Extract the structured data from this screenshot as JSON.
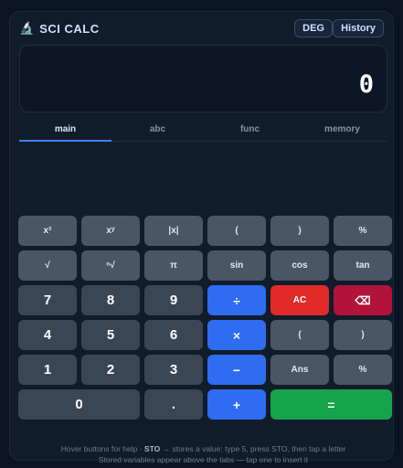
{
  "app": {
    "title": "SCI CALC",
    "icon": "microscope-icon",
    "deg_label": "DEG",
    "history_label": "History"
  },
  "display": {
    "value": "0"
  },
  "tabs": [
    {
      "label": "main",
      "active": true
    },
    {
      "label": "abc",
      "active": false
    },
    {
      "label": "func",
      "active": false
    },
    {
      "label": "memory",
      "active": false
    }
  ],
  "keys": {
    "r1": [
      "x²",
      "xʸ",
      "|x|",
      "(",
      ")",
      "%"
    ],
    "r2": [
      "√",
      "ⁿ√",
      "π",
      "sin",
      "cos",
      "tan"
    ],
    "r3": [
      "7",
      "8",
      "9",
      "÷",
      "AC",
      "⌫"
    ],
    "r4": [
      "4",
      "5",
      "6",
      "×",
      "(",
      ")"
    ],
    "r5": [
      "1",
      "2",
      "3",
      "−",
      "Ans",
      "%"
    ],
    "r6": [
      "0",
      ".",
      "+",
      "="
    ]
  },
  "help": {
    "line1_pre": "Hover buttons for help · ",
    "line1_sto": "STO",
    "line1_post": " → stores a value: type 5, press STO, then tap a letter",
    "line2": "Stored variables appear above the tabs — tap one to insert it"
  },
  "colors": {
    "background": "#0b1422",
    "panel": "#111c2b",
    "operator": "#2e6cf2",
    "clear": "#e02a2a",
    "backspace": "#b1133a",
    "equals": "#16a34a",
    "tab_active_underline": "#3b82f6"
  }
}
